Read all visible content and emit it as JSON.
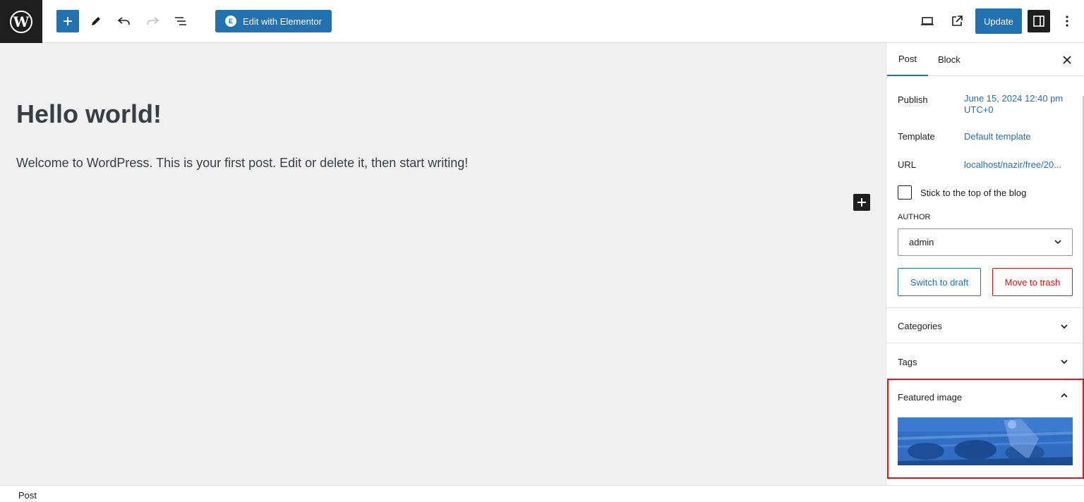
{
  "header": {
    "logo": "W",
    "elementor_button_label": "Edit with Elementor",
    "elementor_icon_label": "E",
    "update_button_label": "Update",
    "icons": [
      "add-block-icon",
      "pencil-icon",
      "undo-icon",
      "redo-icon",
      "list-view-icon",
      "desktop-preview-icon",
      "external-view-icon",
      "sidebar-toggle-icon",
      "options-icon"
    ]
  },
  "editor": {
    "title": "Hello world!",
    "paragraph": "Welcome to WordPress. This is your first post. Edit or delete it, then start writing!"
  },
  "sidebar": {
    "tabs": [
      "Post",
      "Block"
    ],
    "active_tab": "Post",
    "publish_label": "Publish",
    "publish_value_line1": "June 15, 2024 12:40 pm",
    "publish_value_line2": "UTC+0",
    "template_label": "Template",
    "template_value": "Default template",
    "url_label": "URL",
    "url_value": "localhost/nazir/free/20...",
    "sticky_label": "Stick to the top of the blog",
    "author_label": "AUTHOR",
    "author_value": "admin",
    "switch_draft_label": "Switch to draft",
    "move_trash_label": "Move to trash",
    "panels": {
      "categories": "Categories",
      "tags": "Tags",
      "featured_image": "Featured image"
    }
  },
  "footer": {
    "breadcrumb": "Post"
  },
  "colors": {
    "accent": "#2271b1",
    "danger": "#cc1818",
    "highlight": "#d21d1d",
    "dark": "#1e1e1e",
    "canvas": "#f0f0f0"
  }
}
